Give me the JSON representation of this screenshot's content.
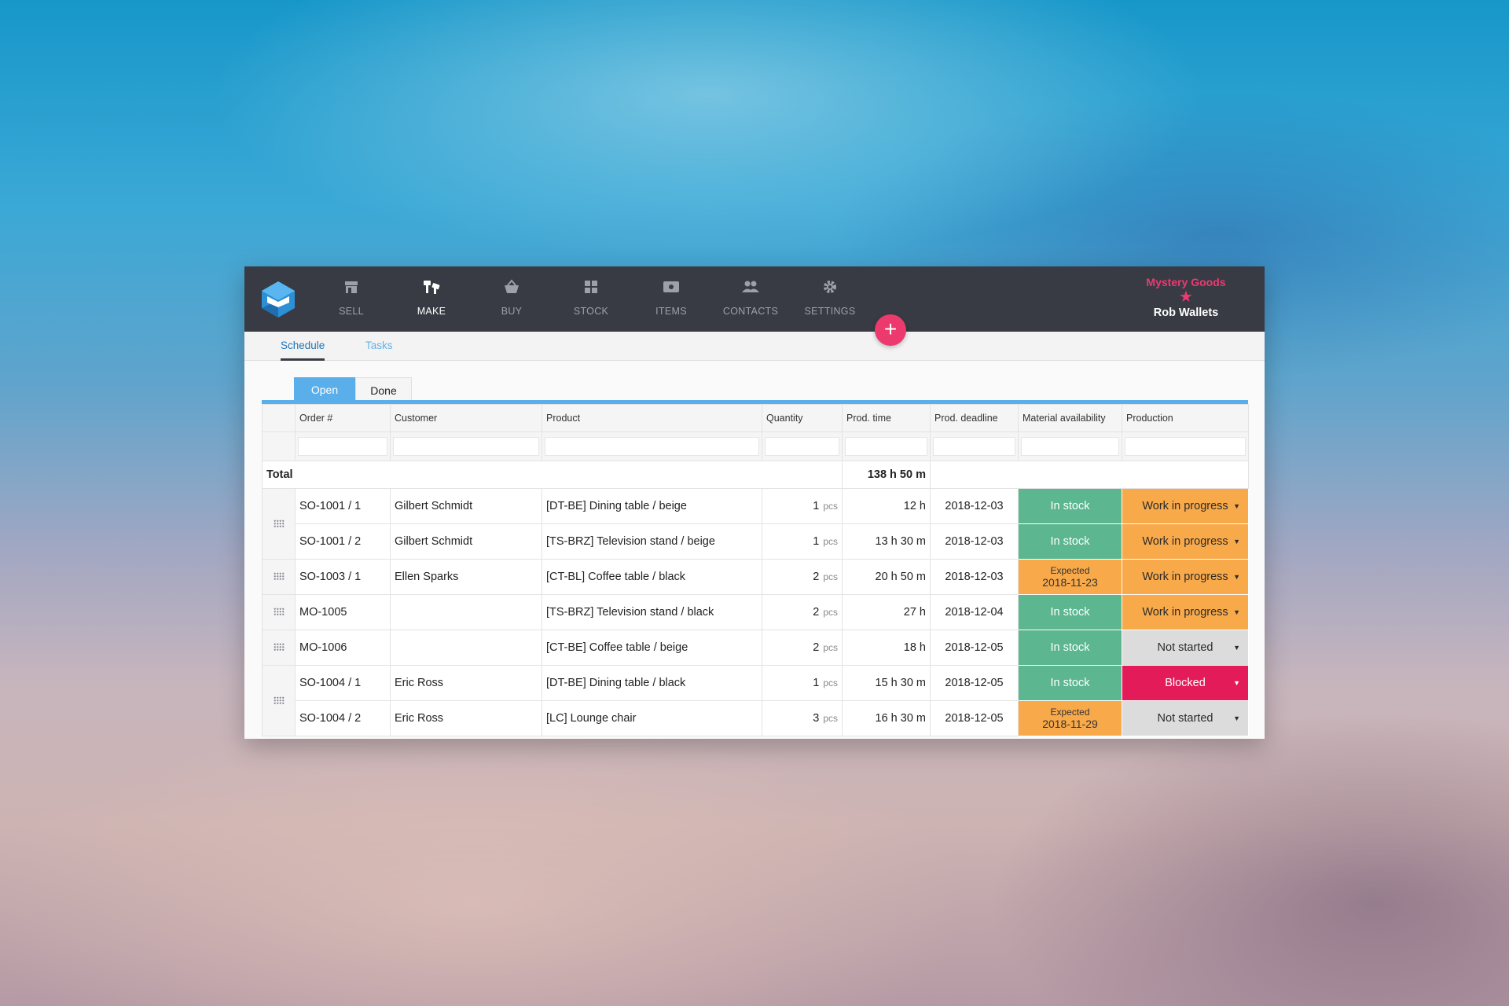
{
  "nav": {
    "items": [
      {
        "label": "SELL",
        "icon": "store-icon"
      },
      {
        "label": "MAKE",
        "icon": "hammer-icon"
      },
      {
        "label": "BUY",
        "icon": "basket-icon"
      },
      {
        "label": "STOCK",
        "icon": "boxes-icon"
      },
      {
        "label": "ITEMS",
        "icon": "tag-icon"
      },
      {
        "label": "CONTACTS",
        "icon": "people-icon"
      },
      {
        "label": "SETTINGS",
        "icon": "gear-icon"
      }
    ],
    "active": "MAKE"
  },
  "account": {
    "company": "Mystery Goods",
    "user": "Rob Wallets"
  },
  "fab": {
    "label": "+"
  },
  "subtabs": {
    "schedule": "Schedule",
    "tasks": "Tasks"
  },
  "filter_tabs": {
    "open": "Open",
    "done": "Done"
  },
  "table": {
    "headers": {
      "order": "Order #",
      "customer": "Customer",
      "product": "Product",
      "quantity": "Quantity",
      "prod_time": "Prod. time",
      "prod_deadline": "Prod. deadline",
      "material": "Material availability",
      "production": "Production"
    },
    "total": {
      "label": "Total",
      "prod_time": "138 h 50 m"
    },
    "rows": [
      {
        "order": "SO-1001 / 1",
        "customer": "Gilbert Schmidt",
        "product": "[DT-BE] Dining table / beige",
        "qty": "1",
        "unit": "pcs",
        "prod_time": "12 h",
        "deadline": "2018-12-03",
        "material": "In stock",
        "production": "Work in progress"
      },
      {
        "order": "SO-1001 / 2",
        "customer": "Gilbert Schmidt",
        "product": "[TS-BRZ] Television stand / beige",
        "qty": "1",
        "unit": "pcs",
        "prod_time": "13 h 30 m",
        "deadline": "2018-12-03",
        "material": "In stock",
        "production": "Work in progress"
      },
      {
        "order": "SO-1003 / 1",
        "customer": "Ellen Sparks",
        "product": "[CT-BL] Coffee table / black",
        "qty": "2",
        "unit": "pcs",
        "prod_time": "20 h 50 m",
        "deadline": "2018-12-03",
        "material_label": "Expected",
        "material_date": "2018-11-23",
        "production": "Work in progress"
      },
      {
        "order": "MO-1005",
        "customer": "",
        "product": "[TS-BRZ] Television stand / black",
        "qty": "2",
        "unit": "pcs",
        "prod_time": "27 h",
        "deadline": "2018-12-04",
        "material": "In stock",
        "production": "Work in progress"
      },
      {
        "order": "MO-1006",
        "customer": "",
        "product": "[CT-BE] Coffee table / beige",
        "qty": "2",
        "unit": "pcs",
        "prod_time": "18 h",
        "deadline": "2018-12-05",
        "material": "In stock",
        "production": "Not started"
      },
      {
        "order": "SO-1004 / 1",
        "customer": "Eric Ross",
        "product": "[DT-BE] Dining table / black",
        "qty": "1",
        "unit": "pcs",
        "prod_time": "15 h 30 m",
        "deadline": "2018-12-05",
        "material": "In stock",
        "production": "Blocked"
      },
      {
        "order": "SO-1004 / 2",
        "customer": "Eric Ross",
        "product": "[LC] Lounge chair",
        "qty": "3",
        "unit": "pcs",
        "prod_time": "16 h 30 m",
        "deadline": "2018-12-05",
        "material_label": "Expected",
        "material_date": "2018-11-29",
        "production": "Not started"
      }
    ]
  },
  "colors": {
    "topbar": "#383b43",
    "accent_pink": "#ec3a6e",
    "tab_blue": "#5aaeea",
    "in_stock_green": "#5cb690",
    "wip_orange": "#f8a94a",
    "blocked_red": "#e31b58",
    "not_started_gray": "#dcdcdc"
  }
}
